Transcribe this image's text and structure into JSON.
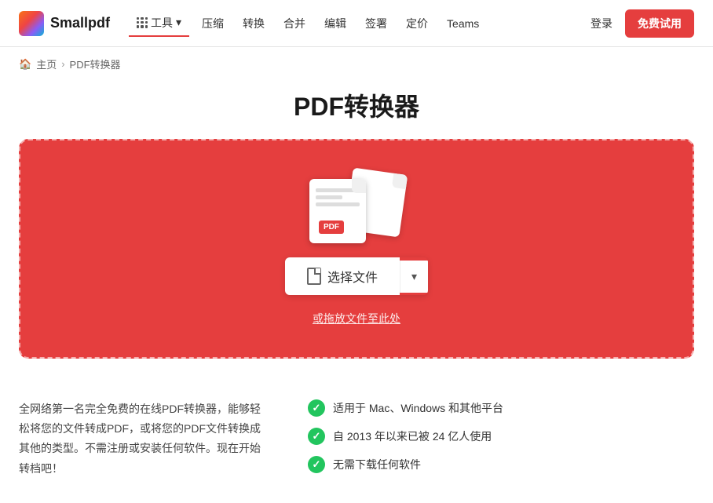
{
  "brand": {
    "name": "Smallpdf"
  },
  "nav": {
    "tools_label": "工具",
    "links": [
      "压缩",
      "转换",
      "合并",
      "编辑",
      "签署",
      "定价",
      "Teams"
    ],
    "login_label": "登录",
    "trial_label": "免费试用"
  },
  "breadcrumb": {
    "home": "主页",
    "separator": "›",
    "current": "PDF转换器"
  },
  "page": {
    "title": "PDF转换器"
  },
  "dropzone": {
    "choose_label": "选择文件",
    "hint": "或拖放文件至此处"
  },
  "info": {
    "description": "全网络第一名完全免费的在线PDF转换器，能够轻松将您的文件转成PDF，或将您的PDF文件转换成其他的类型。不需注册或安装任何软件。现在开始转档吧！",
    "features": [
      "适用于 Mac、Windows 和其他平台",
      "自 2013 年以来已被 24 亿人使用",
      "无需下载任何软件"
    ]
  },
  "colors": {
    "red": "#e53e3e",
    "green": "#22c55e"
  }
}
